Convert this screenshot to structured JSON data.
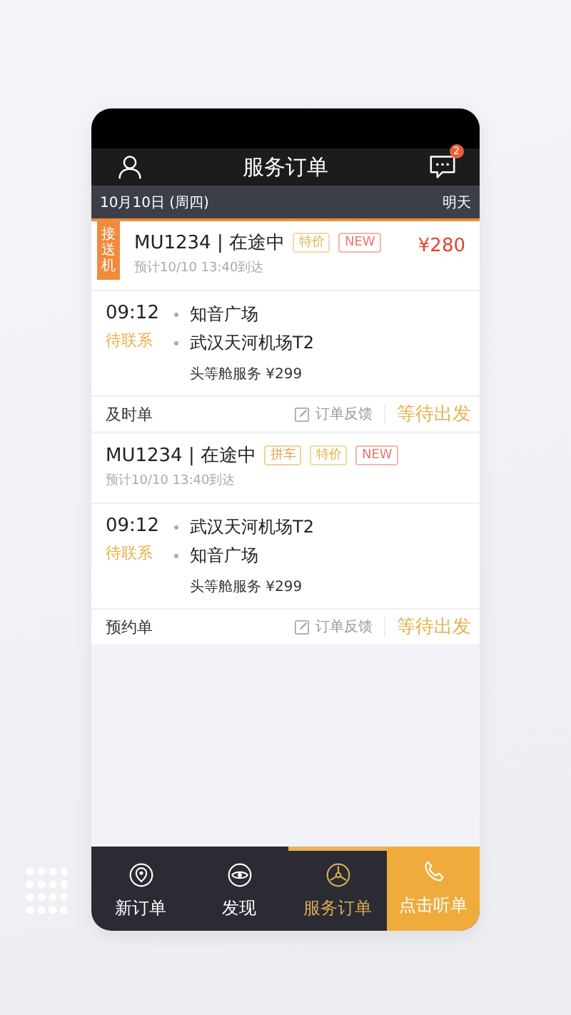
{
  "header": {
    "title": "服务订单",
    "badge": "2"
  },
  "date_bar": {
    "date": "10月10日 (周四)",
    "day": "明天"
  },
  "orders": [
    {
      "tag": "接送机",
      "flight": "MU1234 | 在途中",
      "labels": [
        {
          "text": "特价",
          "kind": "deal"
        },
        {
          "text": "NEW",
          "kind": "new"
        }
      ],
      "price": "¥280",
      "eta": "预计10/10 13:40到达",
      "time": "09:12",
      "status": "待联系",
      "stops": [
        "知音广场",
        "武汉天河机场T2"
      ],
      "service": "头等舱服务 ¥299",
      "type": "及时单",
      "feedback": "订单反馈",
      "action": "等待出发"
    },
    {
      "flight": "MU1234 | 在途中",
      "labels": [
        {
          "text": "拼车",
          "kind": "pool"
        },
        {
          "text": "特价",
          "kind": "deal"
        },
        {
          "text": "NEW",
          "kind": "new"
        }
      ],
      "eta": "预计10/10 13:40到达",
      "time": "09:12",
      "status": "待联系",
      "stops": [
        "武汉天河机场T2",
        "知音广场"
      ],
      "service": "头等舱服务 ¥299",
      "type": "预约单",
      "feedback": "订单反馈",
      "action": "等待出发"
    }
  ],
  "tabs": [
    {
      "label": "新订单",
      "kind": "pin",
      "selected": false
    },
    {
      "label": "发现",
      "kind": "eye",
      "selected": false
    },
    {
      "label": "服务订单",
      "kind": "wheel",
      "selected": true
    }
  ],
  "call_button": {
    "label": "点击听单"
  }
}
